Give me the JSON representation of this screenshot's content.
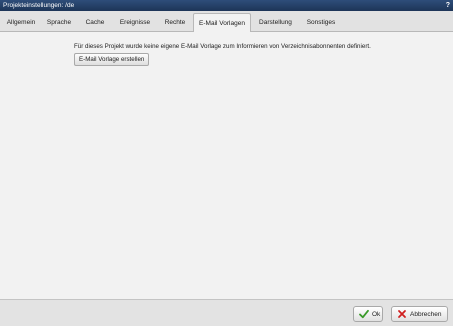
{
  "window": {
    "title": "Projekteinstellungen: /de",
    "help_label": "?"
  },
  "tabs": [
    {
      "label": "Allgemein"
    },
    {
      "label": "Sprache"
    },
    {
      "label": "Cache"
    },
    {
      "label": "Ereignisse"
    },
    {
      "label": "Rechte"
    },
    {
      "label": "E-Mail Vorlagen",
      "active": true
    },
    {
      "label": "Darstellung"
    },
    {
      "label": "Sonstiges"
    }
  ],
  "content": {
    "info_text": "Für dieses Projekt wurde keine eigene E-Mail Vorlage zum Informieren von Verzeichnisabonnenten definiert.",
    "create_button_label": "E-Mail Vorlage erstellen"
  },
  "footer": {
    "ok_label": "Ok",
    "ok_icon": "check-icon",
    "cancel_label": "Abbrechen",
    "cancel_icon": "x-icon"
  },
  "colors": {
    "titlebar": "#1d3557",
    "ok_check": "#3a9a2a",
    "cancel_x": "#d02020"
  }
}
